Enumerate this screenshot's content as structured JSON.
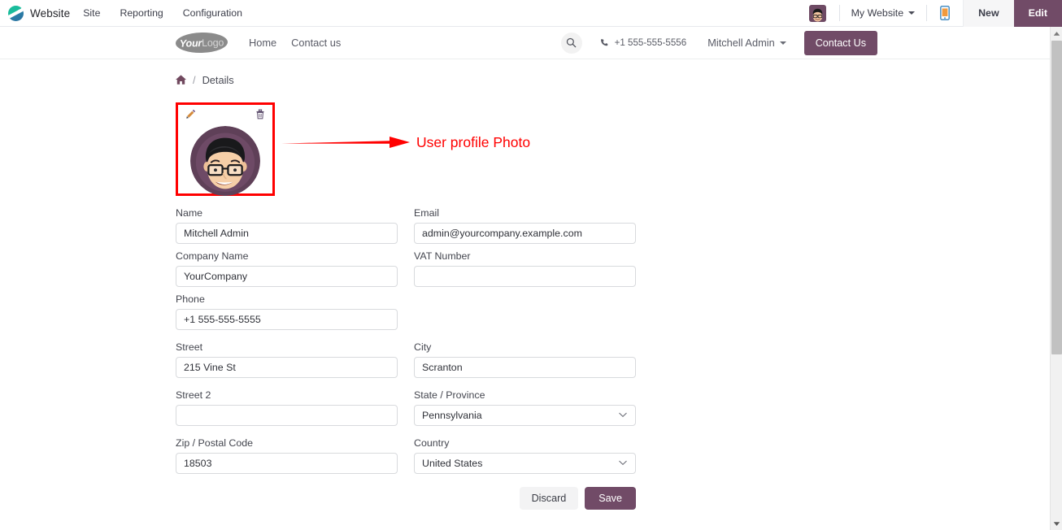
{
  "backend_navbar": {
    "brand": "Website",
    "logo_icon": "odoo-logo-icon",
    "menu": [
      {
        "label": "Site"
      },
      {
        "label": "Reporting"
      },
      {
        "label": "Configuration"
      }
    ],
    "avatar_icon": "user-avatar-icon",
    "website_selector": "My Website",
    "mobile_preview_icon": "mobile-preview-icon",
    "new_label": "New",
    "edit_label": "Edit",
    "edit_bg": "#714b67"
  },
  "site_header": {
    "logo_bold": "Your",
    "logo_light": "Logo",
    "nav": [
      {
        "label": "Home"
      },
      {
        "label": "Contact us"
      }
    ],
    "search_icon": "search-icon",
    "phone_icon": "phone-icon",
    "phone": "+1 555-555-5556",
    "user_name": "Mitchell Admin",
    "contact_button": "Contact Us",
    "accent": "#714b67"
  },
  "breadcrumb": {
    "home_icon": "home-icon",
    "separator": "/",
    "current": "Details"
  },
  "profile_image": {
    "edit_icon": "pencil-edit-icon",
    "delete_icon": "trash-delete-icon",
    "avatar_icon": "user-profile-photo-icon",
    "highlight_color": "#ff0000"
  },
  "annotation": {
    "text": "User profile Photo",
    "color": "#ff0000",
    "arrow_icon": "red-arrow-icon"
  },
  "form": {
    "fields": {
      "name": {
        "label": "Name",
        "value": "Mitchell Admin",
        "placeholder": ""
      },
      "email": {
        "label": "Email",
        "value": "admin@yourcompany.example.com",
        "placeholder": ""
      },
      "company_name": {
        "label": "Company Name",
        "value": "YourCompany",
        "placeholder": ""
      },
      "vat_number": {
        "label": "VAT Number",
        "value": "",
        "placeholder": ""
      },
      "phone": {
        "label": "Phone",
        "value": "+1 555-555-5555",
        "placeholder": ""
      },
      "street": {
        "label": "Street",
        "value": "215 Vine St",
        "placeholder": ""
      },
      "city": {
        "label": "City",
        "value": "Scranton",
        "placeholder": ""
      },
      "street2": {
        "label": "Street 2",
        "value": "",
        "placeholder": ""
      },
      "state": {
        "label": "State / Province",
        "value": "Pennsylvania",
        "placeholder": ""
      },
      "zip": {
        "label": "Zip / Postal Code",
        "value": "18503",
        "placeholder": ""
      },
      "country": {
        "label": "Country",
        "value": "United States",
        "placeholder": ""
      }
    },
    "discard_label": "Discard",
    "save_label": "Save",
    "save_bg": "#714b67"
  },
  "scrollbar": {
    "up_icon": "scroll-up-arrow-icon",
    "down_icon": "scroll-down-arrow-icon"
  }
}
